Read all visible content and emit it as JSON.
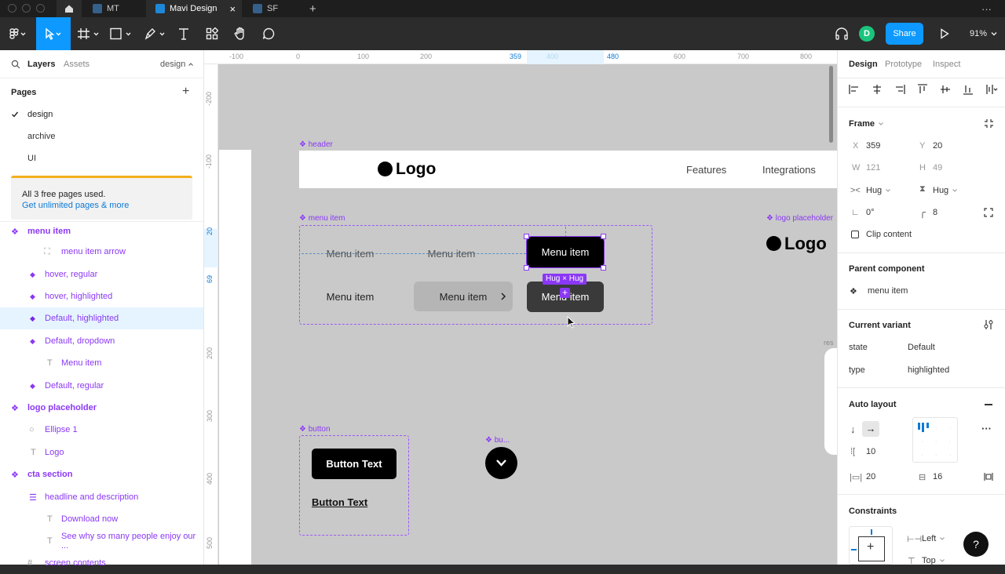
{
  "tabs": {
    "home_icon": "home-icon",
    "tab1": "MT",
    "tab2": "Mavi Design",
    "tab3": "SF",
    "add": "+",
    "more": "···"
  },
  "toolbar": {
    "avatar_initial": "D",
    "share_label": "Share",
    "zoom_label": "91%"
  },
  "left_panel": {
    "tab_layers": "Layers",
    "tab_assets": "Assets",
    "page_dropdown": "design",
    "pages_title": "Pages",
    "pages": [
      "design",
      "archive",
      "UI"
    ],
    "banner_text": "All 3 free pages used.",
    "banner_link": "Get unlimited pages & more",
    "layers": [
      {
        "label": "menu item",
        "kind": "component-set"
      },
      {
        "label": "menu item arrow",
        "kind": "frame"
      },
      {
        "label": "hover, regular",
        "kind": "variant"
      },
      {
        "label": "hover, highlighted",
        "kind": "variant"
      },
      {
        "label": "Default, highlighted",
        "kind": "variant"
      },
      {
        "label": "Default, dropdown",
        "kind": "variant"
      },
      {
        "label": "Menu item",
        "kind": "text"
      },
      {
        "label": "Default, regular",
        "kind": "variant"
      },
      {
        "label": "logo placeholder",
        "kind": "component-set"
      },
      {
        "label": "Ellipse 1",
        "kind": "ellipse"
      },
      {
        "label": "Logo",
        "kind": "text"
      },
      {
        "label": "cta section",
        "kind": "component-set"
      },
      {
        "label": "headline and description",
        "kind": "autolayout"
      },
      {
        "label": "Download now",
        "kind": "text"
      },
      {
        "label": "See why so many people enjoy our ...",
        "kind": "text"
      },
      {
        "label": "screen contents",
        "kind": "frame"
      }
    ]
  },
  "canvas": {
    "ruler_top": [
      "-100",
      "0",
      "100",
      "200",
      "359",
      "400",
      "480",
      "600",
      "700",
      "800"
    ],
    "ruler_left": [
      "-200",
      "-100",
      "20",
      "69",
      "200",
      "300",
      "400",
      "500"
    ],
    "header_label": "header",
    "header_logo": "Logo",
    "header_nav": [
      "Features",
      "Integrations"
    ],
    "menu_label": "menu item",
    "menu_items_row1": [
      "Menu item",
      "Menu item",
      "Menu item"
    ],
    "menu_items_row2": [
      "Menu item",
      "Menu item",
      "Menu item"
    ],
    "hug_badge": "Hug × Hug",
    "logo_placeholder_label": "logo placeholder",
    "logo_placeholder_text": "Logo",
    "button_label": "button",
    "button_primary": "Button Text",
    "button_link": "Button Text",
    "bu_label": "bu...",
    "res_label": "res"
  },
  "right_panel": {
    "tabs": [
      "Design",
      "Prototype",
      "Inspect"
    ],
    "frame_title": "Frame",
    "x_label": "X",
    "x_value": "359",
    "y_label": "Y",
    "y_value": "20",
    "w_label": "W",
    "w_value": "121",
    "h_label": "H",
    "h_value": "49",
    "hug_w": "Hug",
    "hug_h": "Hug",
    "rotation": "0°",
    "radius": "8",
    "clip_content": "Clip content",
    "parent_component_title": "Parent component",
    "parent_component_name": "menu item",
    "current_variant_title": "Current variant",
    "variant_props": [
      {
        "name": "state",
        "value": "Default"
      },
      {
        "name": "type",
        "value": "highlighted"
      }
    ],
    "auto_layout_title": "Auto layout",
    "spacing": "10",
    "padding_h": "20",
    "padding_v": "16",
    "constraints_title": "Constraints",
    "constraint_h": "Left",
    "constraint_v": "Top",
    "help": "?"
  },
  "colors": {
    "accent": "#0d99ff",
    "component": "#8a38f5",
    "canvas_bg": "#c9c9c9",
    "avatar": "#1bc47d"
  }
}
